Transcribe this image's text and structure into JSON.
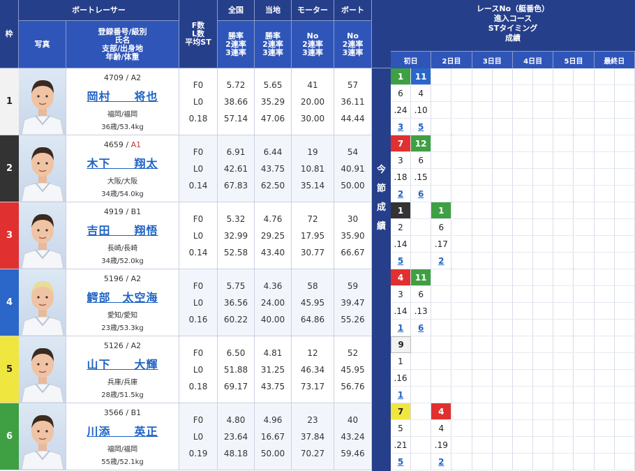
{
  "left_header": {
    "waku": "枠",
    "boat_racer": "ボートレーサー",
    "photo": "写真",
    "info_lines": [
      "登録番号/級別",
      "氏名",
      "支部/出身地",
      "年齢/体重"
    ],
    "fst_lines": [
      "F数",
      "L数",
      "平均ST"
    ],
    "national": "全国",
    "local": "当地",
    "motor": "モーター",
    "boat": "ボート",
    "rate_lines": [
      "勝率",
      "2連率",
      "3連率"
    ],
    "no_lines": [
      "No",
      "2連率",
      "3連率"
    ]
  },
  "separator_label": [
    "今",
    "節",
    "成",
    "績"
  ],
  "right_header": {
    "lines": [
      "レースNo（艇番色）",
      "進入コース",
      "STタイミング",
      "成績"
    ],
    "days": [
      "初日",
      "2日目",
      "3日目",
      "4日目",
      "5日目",
      "最終日"
    ]
  },
  "racers": [
    {
      "waku": "1",
      "waku_color": "#f2f2f2",
      "waku_text": "#222",
      "reg": "4709",
      "class": "A2",
      "name": "岡村　　将也",
      "place": "福岡/福岡",
      "age": "36歳/53.4kg",
      "fst": [
        "F0",
        "L0",
        "0.18"
      ],
      "national": [
        "5.72",
        "38.66",
        "57.14"
      ],
      "local": [
        "5.65",
        "35.29",
        "47.06"
      ],
      "motor": [
        "41",
        "20.00",
        "30.00"
      ],
      "boat": [
        "57",
        "36.11",
        "44.44"
      ],
      "results": [
        {
          "race": "1",
          "color": "c-green",
          "course": "6",
          "st": ".24",
          "finish": "3"
        },
        {
          "race": "11",
          "color": "c-blue",
          "course": "4",
          "st": ".10",
          "finish": "5"
        }
      ]
    },
    {
      "waku": "2",
      "waku_color": "#333333",
      "waku_text": "#fff",
      "reg": "4659",
      "class": "A1",
      "name": "木下　　翔太",
      "place": "大阪/大阪",
      "age": "34歳/54.0kg",
      "fst": [
        "F0",
        "L0",
        "0.14"
      ],
      "national": [
        "6.91",
        "42.61",
        "67.83"
      ],
      "local": [
        "6.44",
        "43.75",
        "62.50"
      ],
      "motor": [
        "19",
        "10.81",
        "35.14"
      ],
      "boat": [
        "54",
        "40.91",
        "50.00"
      ],
      "results": [
        {
          "race": "7",
          "color": "c-red",
          "course": "3",
          "st": ".18",
          "finish": "2"
        },
        {
          "race": "12",
          "color": "c-green",
          "course": "6",
          "st": ".15",
          "finish": "6"
        }
      ]
    },
    {
      "waku": "3",
      "waku_color": "#e03030",
      "waku_text": "#fff",
      "reg": "4919",
      "class": "B1",
      "name": "吉田　　翔悟",
      "place": "長崎/長崎",
      "age": "34歳/52.0kg",
      "fst": [
        "F0",
        "L0",
        "0.14"
      ],
      "national": [
        "5.32",
        "32.99",
        "52.58"
      ],
      "local": [
        "4.76",
        "29.25",
        "43.40"
      ],
      "motor": [
        "72",
        "17.95",
        "30.77"
      ],
      "boat": [
        "30",
        "35.90",
        "66.67"
      ],
      "results": [
        {
          "race": "1",
          "color": "c-black",
          "course": "2",
          "st": ".14",
          "finish": "5"
        },
        {
          "race": "",
          "color": "",
          "course": "",
          "st": "",
          "finish": ""
        },
        {
          "race": "1",
          "color": "c-green",
          "course": "6",
          "st": ".17",
          "finish": "2"
        }
      ]
    },
    {
      "waku": "4",
      "waku_color": "#2a67c9",
      "waku_text": "#fff",
      "reg": "5196",
      "class": "A2",
      "name": "鰐部　太空海",
      "place": "愛知/愛知",
      "age": "23歳/53.3kg",
      "fst": [
        "F0",
        "L0",
        "0.16"
      ],
      "national": [
        "5.75",
        "36.56",
        "60.22"
      ],
      "local": [
        "4.36",
        "24.00",
        "40.00"
      ],
      "motor": [
        "58",
        "45.95",
        "64.86"
      ],
      "boat": [
        "59",
        "39.47",
        "55.26"
      ],
      "results": [
        {
          "race": "4",
          "color": "c-red",
          "course": "3",
          "st": ".14",
          "finish": "1"
        },
        {
          "race": "11",
          "color": "c-green",
          "course": "6",
          "st": ".13",
          "finish": "6"
        }
      ]
    },
    {
      "waku": "5",
      "waku_color": "#f0e640",
      "waku_text": "#222",
      "reg": "5126",
      "class": "A2",
      "name": "山下　　大輝",
      "place": "兵庫/兵庫",
      "age": "28歳/51.5kg",
      "fst": [
        "F0",
        "L0",
        "0.18"
      ],
      "national": [
        "6.50",
        "51.88",
        "69.17"
      ],
      "local": [
        "4.81",
        "31.25",
        "43.75"
      ],
      "motor": [
        "12",
        "46.34",
        "73.17"
      ],
      "boat": [
        "52",
        "45.95",
        "56.76"
      ],
      "results": [
        {
          "race": "9",
          "color": "c-white",
          "course": "1",
          "st": ".16",
          "finish": "1"
        }
      ]
    },
    {
      "waku": "6",
      "waku_color": "#3ea043",
      "waku_text": "#fff",
      "reg": "3566",
      "class": "B1",
      "name": "川添　　英正",
      "place": "福岡/福岡",
      "age": "55歳/52.1kg",
      "fst": [
        "F0",
        "L0",
        "0.19"
      ],
      "national": [
        "4.80",
        "23.64",
        "48.18"
      ],
      "local": [
        "4.96",
        "16.67",
        "50.00"
      ],
      "motor": [
        "23",
        "37.84",
        "70.27"
      ],
      "boat": [
        "40",
        "43.24",
        "59.46"
      ],
      "results": [
        {
          "race": "7",
          "color": "c-yellow",
          "course": "5",
          "st": ".21",
          "finish": "5"
        },
        {
          "race": "",
          "color": "",
          "course": "",
          "st": "",
          "finish": ""
        },
        {
          "race": "4",
          "color": "c-red",
          "course": "4",
          "st": ".19",
          "finish": "2"
        }
      ]
    }
  ]
}
